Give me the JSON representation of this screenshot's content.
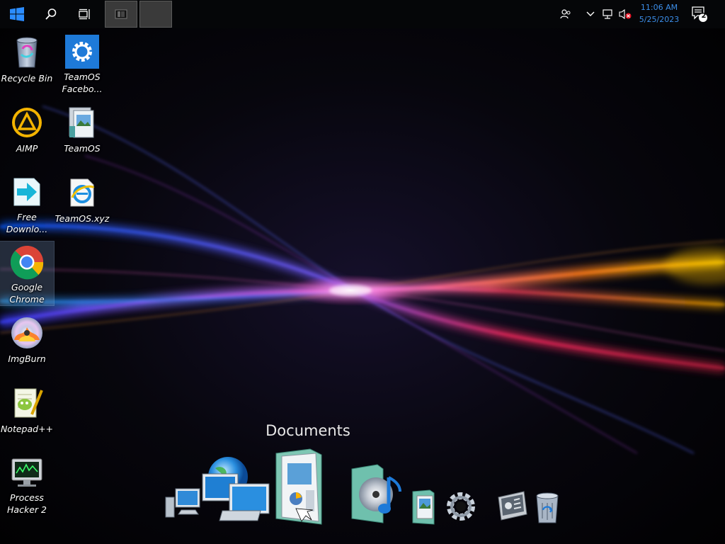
{
  "taskbar": {
    "start_icon": "windows-logo-icon",
    "search_icon": "search-icon",
    "task_view_icon": "task-view-icon",
    "clock": {
      "time": "11:06 AM",
      "date": "5/25/2023"
    },
    "notification_count": "2"
  },
  "desktop": {
    "icons": [
      {
        "label": "Recycle Bin",
        "icon": "recycle-bin-icon"
      },
      {
        "label": "TeamOS Facebo...",
        "icon": "settings-gear-icon"
      },
      {
        "label": "AIMP",
        "icon": "aimp-icon"
      },
      {
        "label": "TeamOS",
        "icon": "folder-images-icon"
      },
      {
        "label": "Free Downlo...",
        "icon": "free-download-manager-icon"
      },
      {
        "label": "TeamOS.xyz",
        "icon": "internet-explorer-icon"
      },
      {
        "label": "Google Chrome",
        "icon": "chrome-icon"
      },
      {
        "label": "ImgBurn",
        "icon": "imgburn-icon"
      },
      {
        "label": "Notepad++",
        "icon": "notepadpp-icon"
      },
      {
        "label": "Process Hacker 2",
        "icon": "process-hacker-icon"
      }
    ]
  },
  "dock": {
    "title": "Documents",
    "items": [
      "computer-icon",
      "network-globe-icon",
      "documents-icon",
      "music-icon",
      "pictures-icon",
      "settings-icon",
      "control-panel-icon",
      "recycle-bin-icon"
    ]
  },
  "colors": {
    "clock_blue": "#3c8ee8",
    "taskbar_bg": "#050608"
  }
}
